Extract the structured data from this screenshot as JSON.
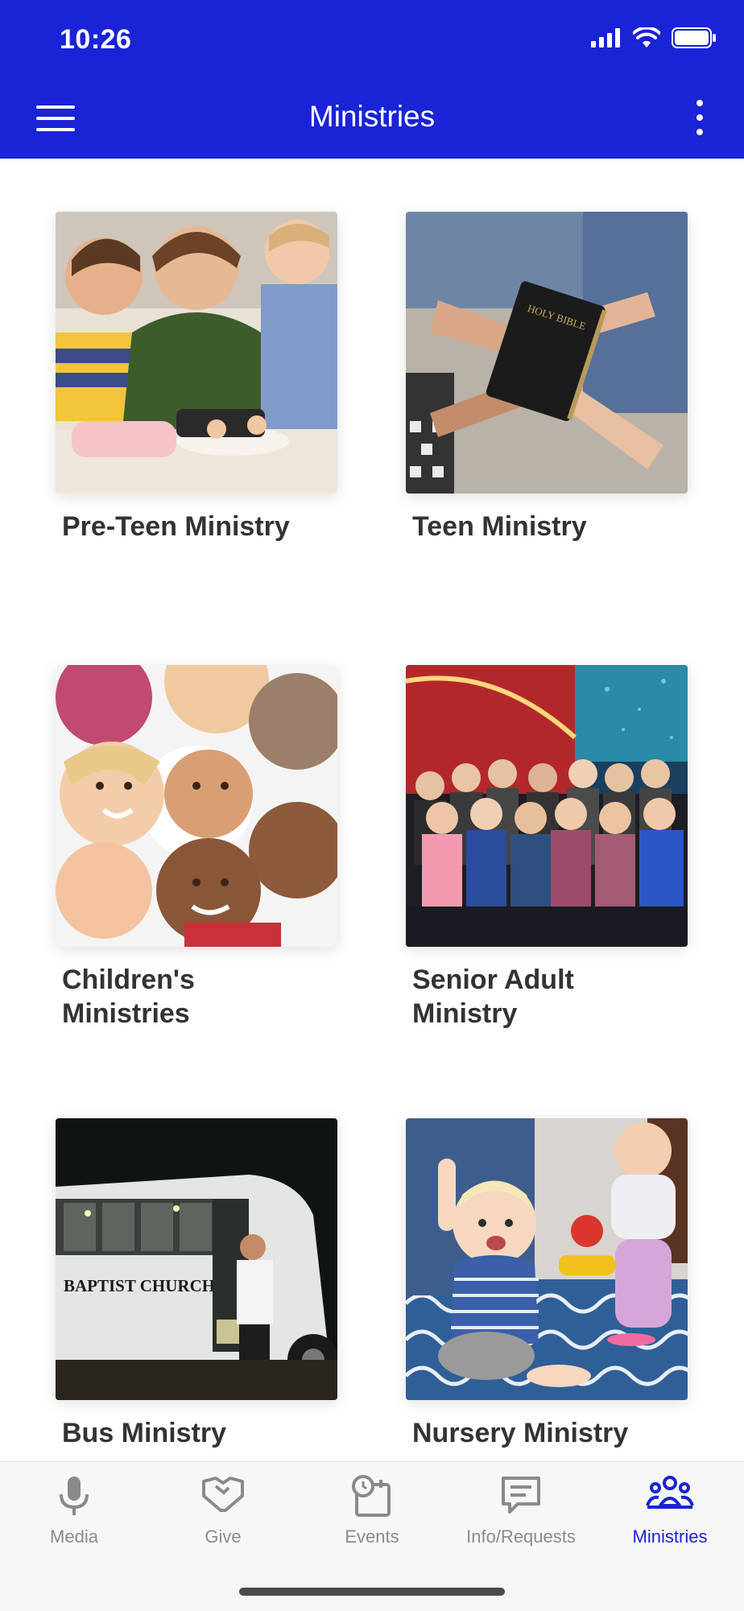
{
  "status_bar": {
    "time": "10:26"
  },
  "header": {
    "title": "Ministries"
  },
  "ministries": [
    {
      "label": "Pre-Teen Ministry",
      "image": "kids-around-table-photo"
    },
    {
      "label": "Teen Ministry",
      "image": "hands-holding-bible-photo"
    },
    {
      "label": "Children's Ministries",
      "image": "children-circle-photo"
    },
    {
      "label": "Senior Adult Ministry",
      "image": "senior-group-photo"
    },
    {
      "label": "Bus Ministry",
      "image": "church-bus-photo"
    },
    {
      "label": "Nursery Ministry",
      "image": "baby-on-rug-photo"
    }
  ],
  "bus_sign": "BAPTIST CHURCH",
  "bible_text": "HOLY BIBLE",
  "bottom_nav": [
    {
      "label": "Media",
      "icon": "microphone-icon",
      "active": false
    },
    {
      "label": "Give",
      "icon": "handshake-icon",
      "active": false
    },
    {
      "label": "Events",
      "icon": "calendar-clock-icon",
      "active": false
    },
    {
      "label": "Info/Requests",
      "icon": "message-icon",
      "active": false
    },
    {
      "label": "Ministries",
      "icon": "people-group-icon",
      "active": true
    }
  ],
  "colors": {
    "header": "#1a23d6",
    "active_tab": "#1a23d6",
    "inactive_tab": "#8a8a8a"
  }
}
